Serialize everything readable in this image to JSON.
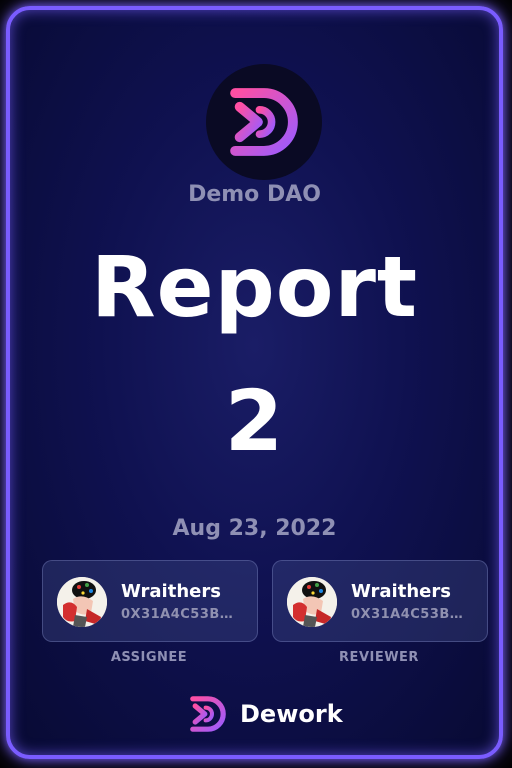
{
  "organization": {
    "name": "Demo DAO",
    "logo_icon": "dework-logo-icon"
  },
  "task": {
    "title_line1": "Report",
    "title_line2": "2",
    "date": "Aug 23, 2022"
  },
  "assignee": {
    "name": "Wraithers",
    "address": "0X31A4C53B…",
    "role_label": "ASSIGNEE",
    "avatar_icon": "avatar-image"
  },
  "reviewer": {
    "name": "Wraithers",
    "address": "0X31A4C53B…",
    "role_label": "REVIEWER",
    "avatar_icon": "avatar-image"
  },
  "brand": {
    "name": "Dework",
    "logo_icon": "dework-logo-icon"
  },
  "colors": {
    "accent_border": "#7a5cff",
    "background": "#0f1150",
    "logo_gradient_start": "#ff4fa3",
    "logo_gradient_end": "#9b5cff"
  }
}
